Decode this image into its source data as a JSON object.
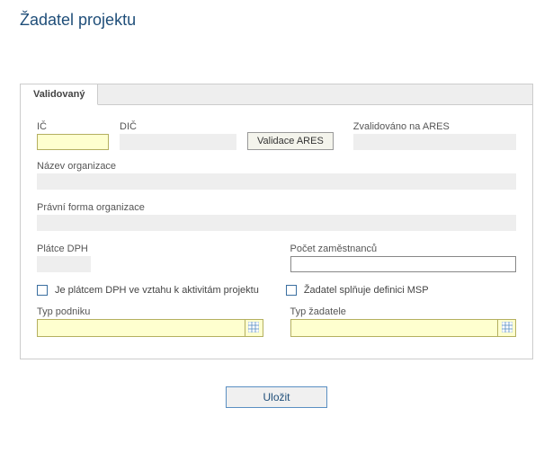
{
  "title": "Žadatel projektu",
  "tab": {
    "label": "Validovaný"
  },
  "fields": {
    "ic_label": "IČ",
    "ic_value": "",
    "dic_label": "DIČ",
    "dic_value": "",
    "validate_btn": "Validace ARES",
    "ares_label": "Zvalidováno na ARES",
    "ares_value": "",
    "org_name_label": "Název organizace",
    "org_name_value": "",
    "legal_form_label": "Právní forma organizace",
    "legal_form_value": "",
    "vat_payer_label": "Plátce DPH",
    "vat_payer_value": "",
    "emp_count_label": "Počet zaměstnanců",
    "emp_count_value": "",
    "chk_vat_label": "Je plátcem DPH ve vztahu k aktivitám projektu",
    "chk_msp_label": "Žadatel splňuje definici MSP",
    "company_type_label": "Typ podniku",
    "company_type_value": "",
    "applicant_type_label": "Typ žadatele",
    "applicant_type_value": ""
  },
  "actions": {
    "save": "Uložit"
  }
}
